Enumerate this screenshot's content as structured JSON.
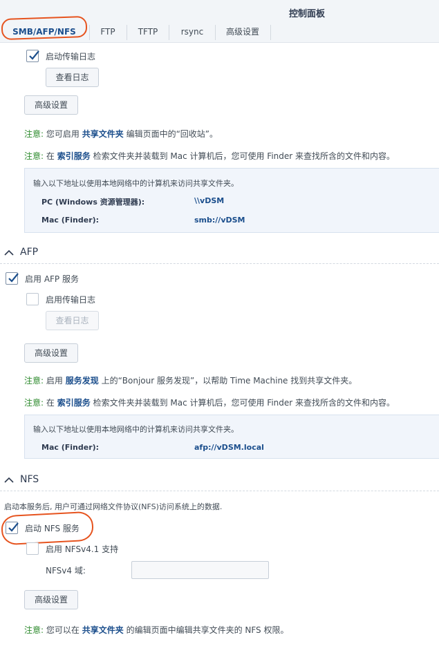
{
  "app": {
    "title": "控制面板"
  },
  "tabs": [
    {
      "label": "SMB/AFP/NFS"
    },
    {
      "label": "FTP"
    },
    {
      "label": "TFTP"
    },
    {
      "label": "rsync"
    },
    {
      "label": "高级设置"
    }
  ],
  "smb": {
    "transfer_log_label": "启动传输日志",
    "view_log": "查看日志",
    "advanced": "高级设置",
    "note1": {
      "prefix": "注意:",
      "before": "您可启用",
      "link": "共享文件夹",
      "after": "编辑页面中的“回收站”。"
    },
    "note2": {
      "prefix": "注意:",
      "before": "在",
      "link": "索引服务",
      "after": "检索文件夹并装载到 Mac 计算机后，您可使用 Finder 来查找所含的文件和内容。"
    },
    "info": {
      "head": "输入以下地址以使用本地网络中的计算机来访问共享文件夹。",
      "rows": [
        {
          "key": "PC (Windows 资源管理器):",
          "value": "\\\\vDSM"
        },
        {
          "key": "Mac (Finder):",
          "value": "smb://vDSM"
        }
      ]
    }
  },
  "afp": {
    "title": "AFP",
    "enable_label": "启用 AFP 服务",
    "transfer_log_label": "启用传输日志",
    "view_log": "查看日志",
    "advanced": "高级设置",
    "note1": {
      "prefix": "注意:",
      "before": "启用",
      "link": "服务发现",
      "after": "上的“Bonjour 服务发现”，以帮助 Time Machine 找到共享文件夹。"
    },
    "note2": {
      "prefix": "注意:",
      "before": "在",
      "link": "索引服务",
      "after": "检索文件夹并装载到 Mac 计算机后，您可使用 Finder 来查找所含的文件和内容。"
    },
    "info": {
      "head": "输入以下地址以使用本地网络中的计算机来访问共享文件夹。",
      "rows": [
        {
          "key": "Mac (Finder):",
          "value": "afp://vDSM.local"
        }
      ]
    }
  },
  "nfs": {
    "title": "NFS",
    "desc": "启动本服务后, 用户可通过网络文件协议(NFS)访问系统上的数据.",
    "enable_label": "启动 NFS 服务",
    "v41_label": "启用 NFSv4.1 支持",
    "domain_label": "NFSv4 域:",
    "domain_value": "",
    "advanced": "高级设置",
    "note1": {
      "prefix": "注意:",
      "before": "您可以在",
      "link": "共享文件夹",
      "after": "的编辑页面中编辑共享文件夹的 NFS 权限。"
    }
  },
  "colors": {
    "accent": "#1b4e8c",
    "note": "#2e8b2e",
    "annotation": "#e6531e"
  }
}
